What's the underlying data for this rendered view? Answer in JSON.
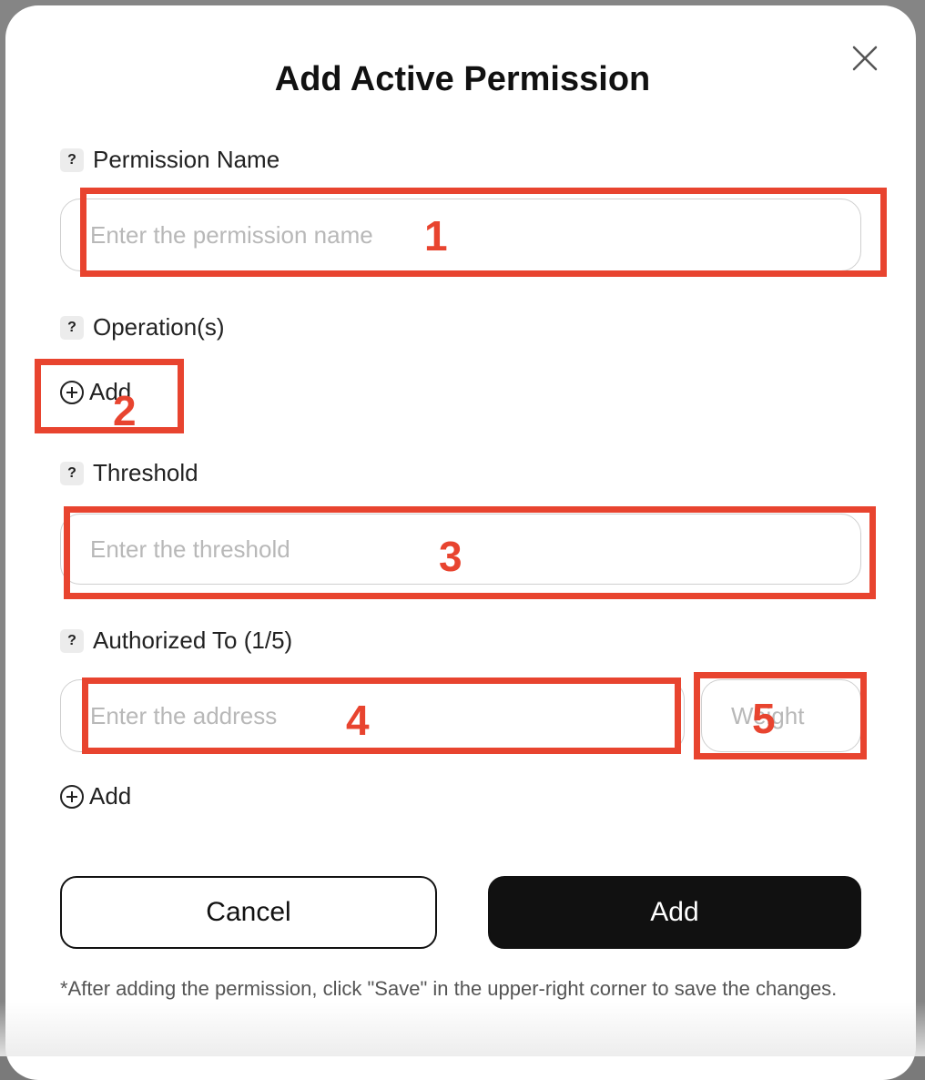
{
  "dialog": {
    "title": "Add Active Permission",
    "close_icon": "close-icon"
  },
  "fields": {
    "permission_name": {
      "label": "Permission Name",
      "help": "?",
      "placeholder": "Enter the permission name",
      "value": ""
    },
    "operations": {
      "label": "Operation(s)",
      "help": "?",
      "add_label": "Add"
    },
    "threshold": {
      "label": "Threshold",
      "help": "?",
      "placeholder": "Enter the threshold",
      "value": ""
    },
    "authorized_to": {
      "label": "Authorized To (1/5)",
      "help": "?",
      "address_placeholder": "Enter the address",
      "weight_placeholder": "Weight",
      "add_label": "Add"
    }
  },
  "buttons": {
    "cancel": "Cancel",
    "add": "Add"
  },
  "footnote": "*After adding the permission, click \"Save\" in the upper-right corner to save the changes.",
  "annotations": {
    "color": "#e8442f",
    "labels": [
      "1",
      "2",
      "3",
      "4",
      "5"
    ]
  }
}
